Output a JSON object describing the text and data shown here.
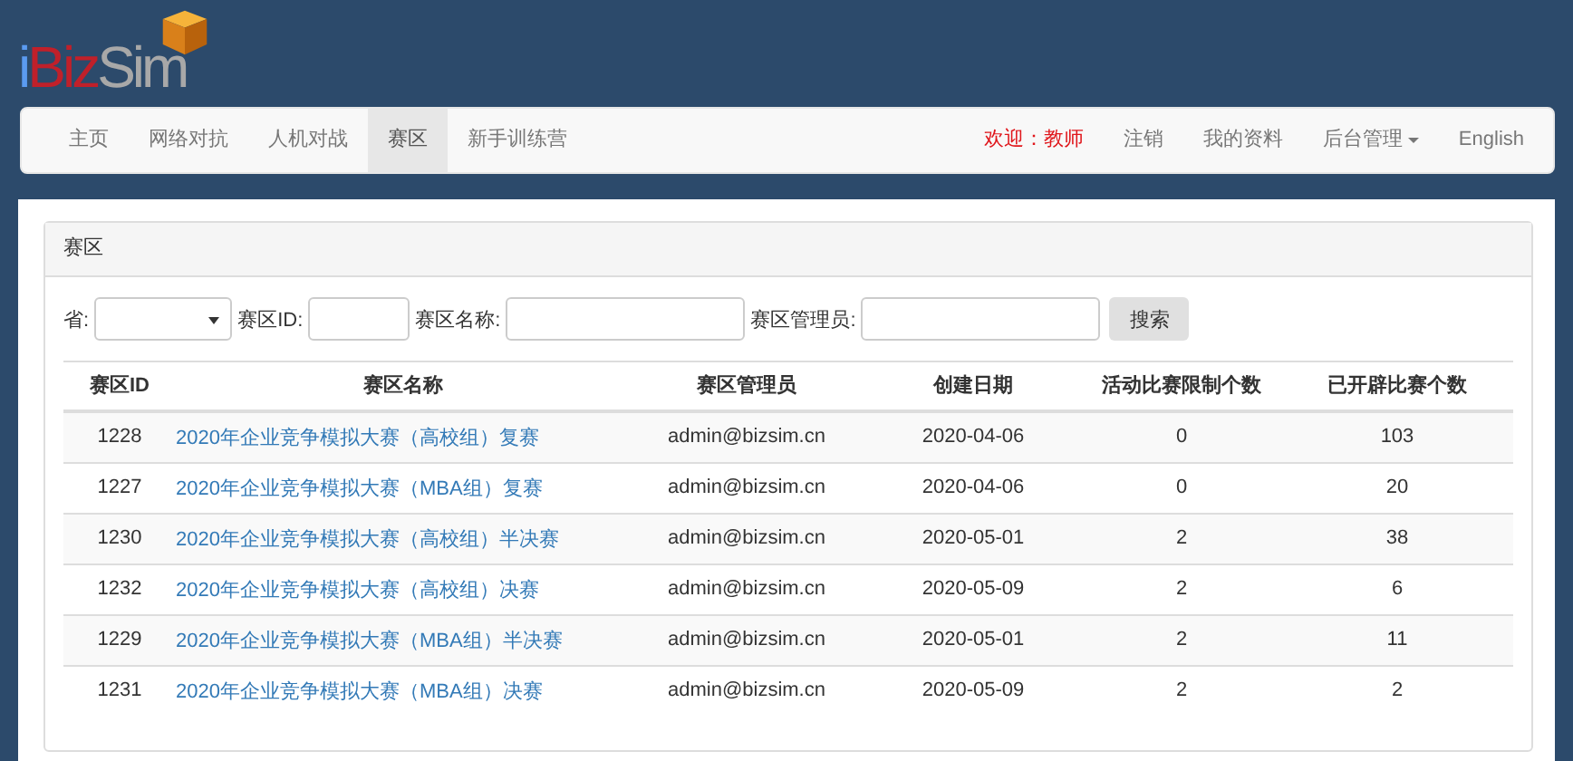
{
  "logo": {
    "parts": [
      {
        "text": "i",
        "color": "#5b9bf0"
      },
      {
        "text": "Biz",
        "color": "#c0202a"
      },
      {
        "text": "Sim",
        "color": "#a8a8a8"
      }
    ]
  },
  "nav": {
    "items": [
      {
        "label": "主页",
        "selected": false
      },
      {
        "label": "网络对抗",
        "selected": false
      },
      {
        "label": "人机对战",
        "selected": false
      },
      {
        "label": "赛区",
        "selected": true
      },
      {
        "label": "新手训练营",
        "selected": false
      }
    ],
    "right": [
      {
        "label": "欢迎：教师",
        "kind": "welcome"
      },
      {
        "label": "注销",
        "kind": "link"
      },
      {
        "label": "我的资料",
        "kind": "link"
      },
      {
        "label": "后台管理",
        "kind": "dropdown"
      },
      {
        "label": "English",
        "kind": "link"
      }
    ]
  },
  "panel": {
    "title": "赛区",
    "filters": [
      {
        "label": "省:",
        "kind": "select"
      },
      {
        "label": "赛区ID:",
        "kind": "short"
      },
      {
        "label": "赛区名称:",
        "kind": "long"
      },
      {
        "label": "赛区管理员:",
        "kind": "long"
      }
    ],
    "search_button": "搜索",
    "table": {
      "columns": [
        "赛区ID",
        "赛区名称",
        "赛区管理员",
        "创建日期",
        "活动比赛限制个数",
        "已开辟比赛个数"
      ],
      "rows": [
        [
          "1228",
          "2020年企业竞争模拟大赛（高校组）复赛",
          "admin@bizsim.cn",
          "2020-04-06",
          "0",
          "103"
        ],
        [
          "1227",
          "2020年企业竞争模拟大赛（MBA组）复赛",
          "admin@bizsim.cn",
          "2020-04-06",
          "0",
          "20"
        ],
        [
          "1230",
          "2020年企业竞争模拟大赛（高校组）半决赛",
          "admin@bizsim.cn",
          "2020-05-01",
          "2",
          "38"
        ],
        [
          "1232",
          "2020年企业竞争模拟大赛（高校组）决赛",
          "admin@bizsim.cn",
          "2020-05-09",
          "2",
          "6"
        ],
        [
          "1229",
          "2020年企业竞争模拟大赛（MBA组）半决赛",
          "admin@bizsim.cn",
          "2020-05-01",
          "2",
          "11"
        ],
        [
          "1231",
          "2020年企业竞争模拟大赛（MBA组）决赛",
          "admin@bizsim.cn",
          "2020-05-09",
          "2",
          "2"
        ]
      ]
    }
  }
}
